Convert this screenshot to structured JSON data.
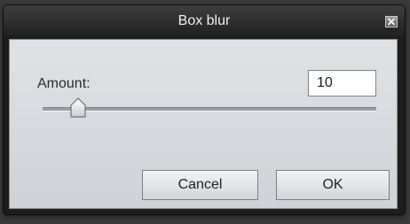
{
  "window": {
    "title": "Box blur",
    "close_icon": "close-icon"
  },
  "form": {
    "amount_label": "Amount:",
    "amount_value": "10",
    "slider_level_fraction": 0.1
  },
  "buttons": {
    "cancel_label": "Cancel",
    "ok_label": "OK"
  }
}
